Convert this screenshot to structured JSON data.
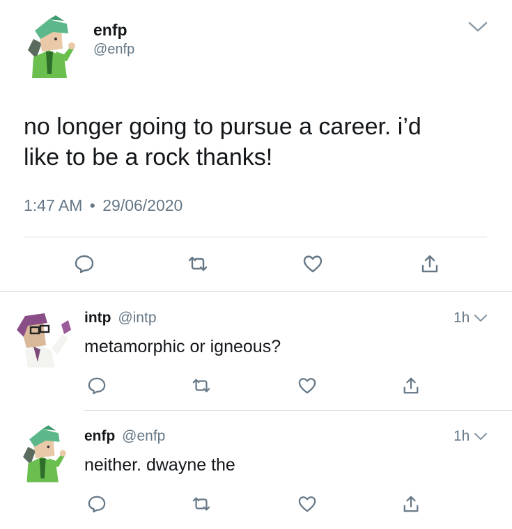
{
  "main_tweet": {
    "display_name": "enfp",
    "handle": "@enfp",
    "text_line1": "no longer going to pursue a career. i’d",
    "text_line2": "like to be a rock thanks!",
    "time": "1:47 AM",
    "separator": "•",
    "date": "29/06/2020"
  },
  "replies": [
    {
      "display_name": "intp",
      "handle": "@intp",
      "age": "1h",
      "text": "metamorphic or igneous?"
    },
    {
      "display_name": "enfp",
      "handle": "@enfp",
      "age": "1h",
      "text": "neither. dwayne the"
    }
  ],
  "actions": [
    "reply",
    "retweet",
    "like",
    "share"
  ],
  "colors": {
    "text": "#14171a",
    "muted": "#657786",
    "divider": "#d6d9dc",
    "icon": "#657786"
  },
  "icons": {
    "reply": "speech-bubble-icon",
    "retweet": "retweet-arrows-icon",
    "like": "heart-outline-icon",
    "share": "share-upload-icon",
    "caret": "chevron-down-icon"
  }
}
